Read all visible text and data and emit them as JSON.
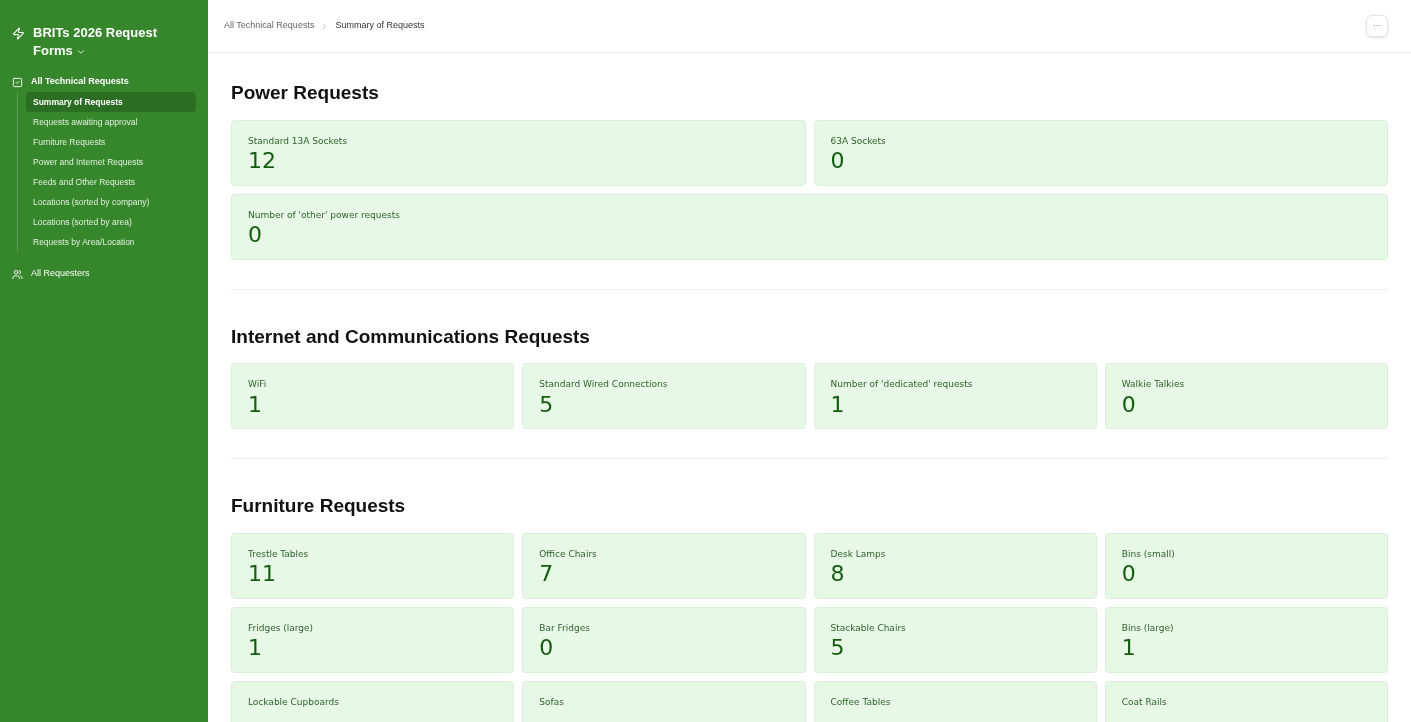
{
  "sidebar": {
    "title": "BRITs 2026 Request Forms",
    "groups": [
      {
        "label": "All Technical Requests",
        "kind": "checklist",
        "expanded": true,
        "items": [
          {
            "label": "Summary of Requests",
            "selected": true
          },
          {
            "label": "Requests awaiting approval",
            "selected": false
          },
          {
            "label": "Furniture Requests",
            "selected": false
          },
          {
            "label": "Power and Internet Requests",
            "selected": false
          },
          {
            "label": "Feeds and Other Requests",
            "selected": false
          },
          {
            "label": "Locations (sorted by company)",
            "selected": false
          },
          {
            "label": "Locations (sorted by area)",
            "selected": false
          },
          {
            "label": "Requests by Area/Location",
            "selected": false
          }
        ]
      },
      {
        "label": "All Requesters",
        "kind": "people",
        "expanded": false
      }
    ]
  },
  "breadcrumb": [
    "All Technical Requests",
    "Summary of Requests"
  ],
  "more_button": "···",
  "sections": [
    {
      "title": "Power Requests",
      "kind": "pair",
      "cards": [
        {
          "label": "Standard 13A Sockets",
          "value": "12",
          "wide": false
        },
        {
          "label": "63A Sockets",
          "value": "0",
          "wide": false
        },
        {
          "label": "Number of 'other' power requests",
          "value": "0",
          "wide": true
        }
      ]
    },
    {
      "title": "Internet and Communications Requests",
      "kind": "quad",
      "cards": [
        {
          "label": "WiFi",
          "value": "1",
          "wide": false
        },
        {
          "label": "Standard Wired Connections",
          "value": "5",
          "wide": false
        },
        {
          "label": "Number of 'dedicated' requests",
          "value": "1",
          "wide": false
        },
        {
          "label": "Walkie Talkies",
          "value": "0",
          "wide": false
        }
      ]
    },
    {
      "title": "Furniture Requests",
      "kind": "quad",
      "cards": [
        {
          "label": "Trestle Tables",
          "value": "11",
          "wide": false
        },
        {
          "label": "Office Chairs",
          "value": "7",
          "wide": false
        },
        {
          "label": "Desk Lamps",
          "value": "8",
          "wide": false
        },
        {
          "label": "Bins (small)",
          "value": "0",
          "wide": false
        },
        {
          "label": "Fridges (large)",
          "value": "1",
          "wide": false
        },
        {
          "label": "Bar Fridges",
          "value": "0",
          "wide": false
        },
        {
          "label": "Stackable Chairs",
          "value": "5",
          "wide": false
        },
        {
          "label": "Bins (large)",
          "value": "1",
          "wide": false
        },
        {
          "label": "Lockable Cupboards",
          "wide": false
        },
        {
          "label": "Sofas",
          "wide": false
        },
        {
          "label": "Coffee Tables",
          "wide": false
        },
        {
          "label": "Coat Rails",
          "wide": false
        }
      ]
    }
  ]
}
